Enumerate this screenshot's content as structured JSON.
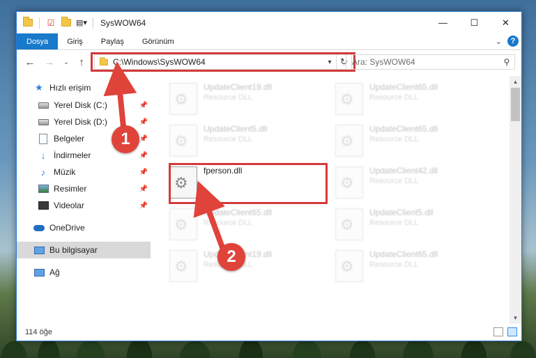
{
  "window": {
    "title": "SysWOW64"
  },
  "ribbon": {
    "tabs": [
      "Dosya",
      "Giriş",
      "Paylaş",
      "Görünüm"
    ]
  },
  "nav": {
    "address": "C:\\Windows\\SysWOW64",
    "search_placeholder": "Ara: SysWOW64"
  },
  "sidebar": {
    "quick_access": "Hızlı erişim",
    "items": [
      {
        "label": "Yerel Disk (C:)",
        "icon": "drive-icon"
      },
      {
        "label": "Yerel Disk (D:)",
        "icon": "drive-icon"
      },
      {
        "label": "Belgeler",
        "icon": "documents-icon"
      },
      {
        "label": "İndirmeler",
        "icon": "download-icon"
      },
      {
        "label": "Müzik",
        "icon": "music-icon"
      },
      {
        "label": "Resimler",
        "icon": "pictures-icon"
      },
      {
        "label": "Videolar",
        "icon": "videos-icon"
      }
    ],
    "onedrive": "OneDrive",
    "this_pc": "Bu bilgisayar",
    "network": "Ağ"
  },
  "files": [
    {
      "name": "UpdateClient19.dll",
      "type": "Resource DLL"
    },
    {
      "name": "UpdateClient65.dll",
      "type": "Resource DLL"
    },
    {
      "name": "UpdateClient5.dll",
      "type": "Resource DLL"
    },
    {
      "name": "UpdateClient65.dll",
      "type": "Resource DLL"
    },
    {
      "name": "fperson.dll",
      "type": ""
    },
    {
      "name": "UpdateClient42.dll",
      "type": "Resource DLL"
    },
    {
      "name": "UpdateClient65.dll",
      "type": "Resource DLL"
    },
    {
      "name": "UpdateClient5.dll",
      "type": "Resource DLL"
    },
    {
      "name": "UpdateClient19.dll",
      "type": "Resource DLL"
    },
    {
      "name": "UpdateClient65.dll",
      "type": "Resource DLL"
    }
  ],
  "status": {
    "item_count": "114 öğe"
  },
  "annotations": {
    "step1": "1",
    "step2": "2",
    "color": "#d33a3a"
  }
}
